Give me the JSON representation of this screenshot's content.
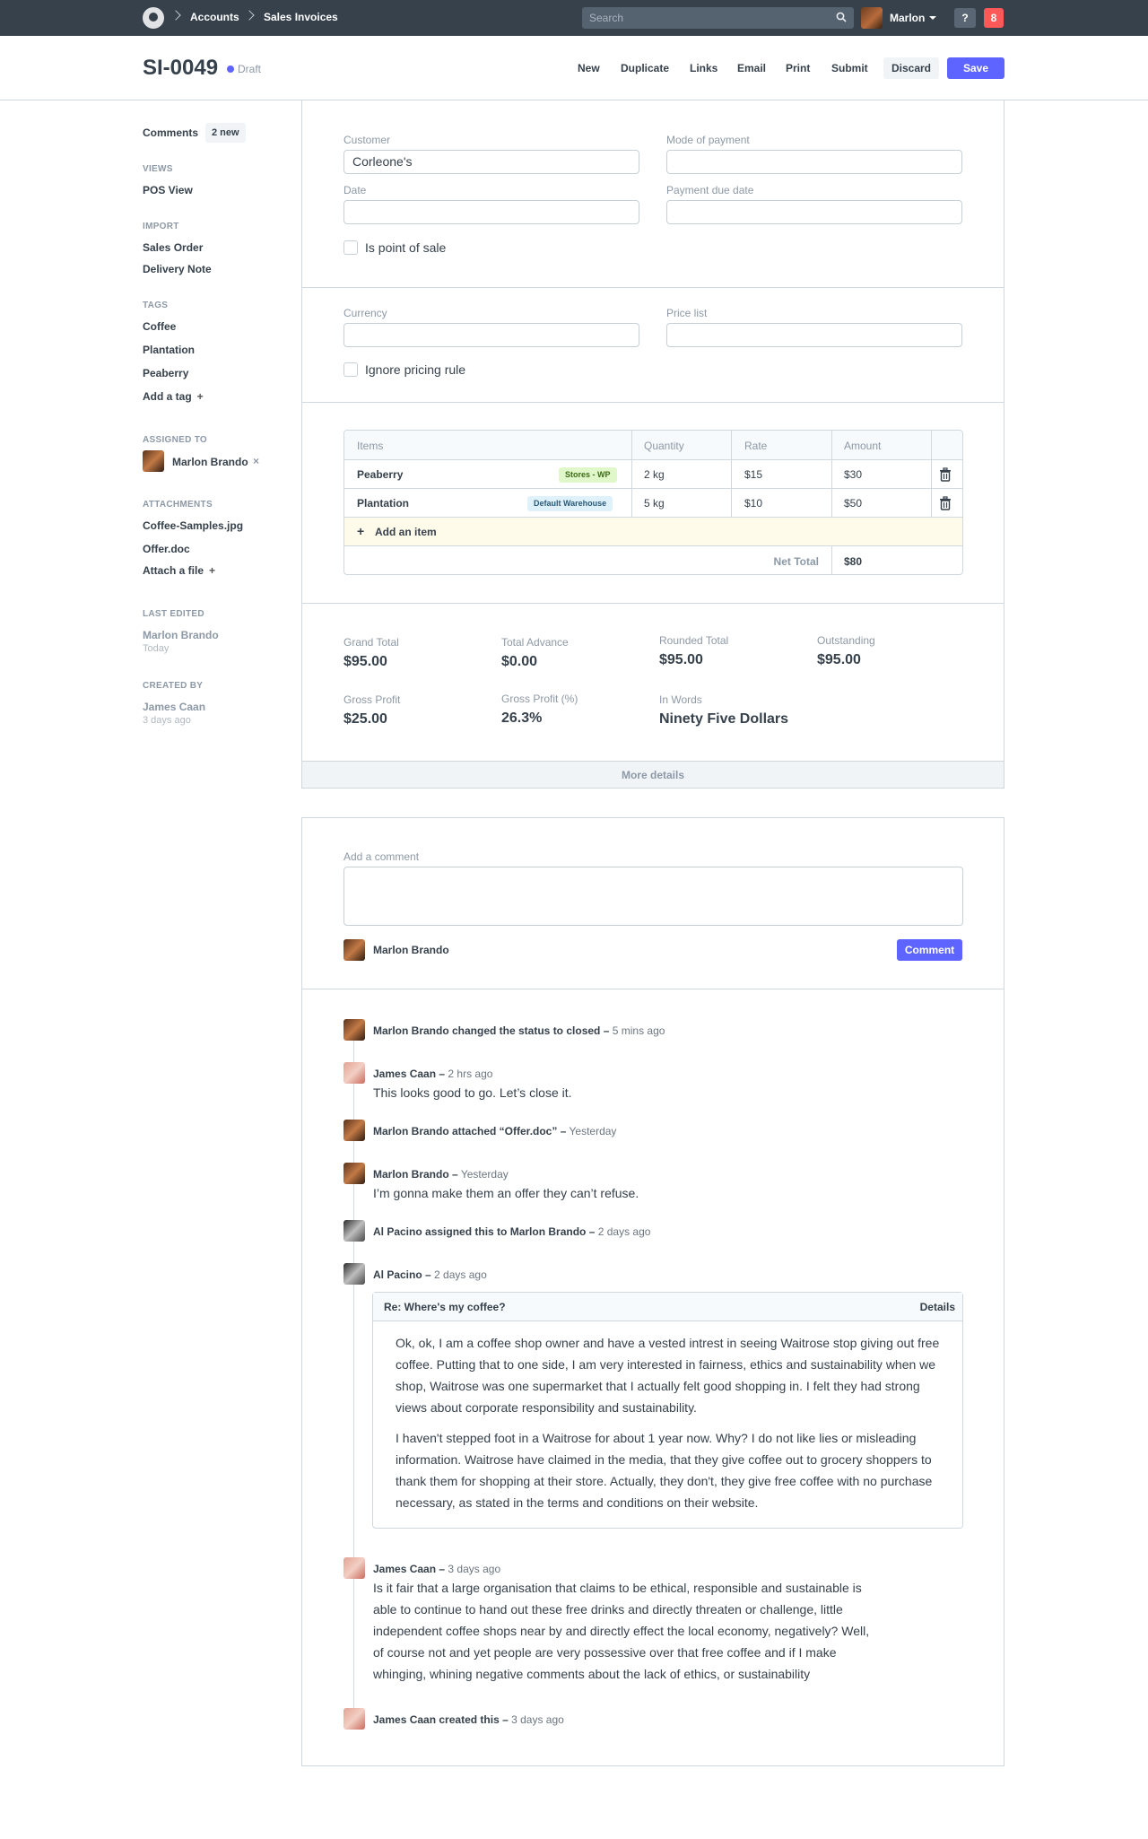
{
  "nav": {
    "breadcrumbs": [
      "Accounts",
      "Sales Invoices"
    ],
    "search_placeholder": "Search",
    "user_name": "Marlon",
    "help": "?",
    "notifications": "8"
  },
  "header": {
    "doc_id": "SI-0049",
    "status": "Draft",
    "actions": [
      "New",
      "Duplicate",
      "Links",
      "Email",
      "Print",
      "Submit"
    ],
    "discard": "Discard",
    "save": "Save"
  },
  "sidebar": {
    "comments_label": "Comments",
    "comments_badge": "2 new",
    "views_label": "Views",
    "views": [
      "POS View"
    ],
    "import_label": "Import",
    "imports": [
      "Sales Order",
      "Delivery Note"
    ],
    "tags_label": "Tags",
    "tags": [
      "Coffee",
      "Plantation",
      "Peaberry"
    ],
    "add_tag": "Add a tag",
    "assigned_label": "Assigned to",
    "assigned_to": "Marlon Brando",
    "attachments_label": "Attachments",
    "attachments": [
      "Coffee-Samples.jpg",
      "Offer.doc"
    ],
    "attach_file": "Attach a file",
    "last_edited_label": "Last edited",
    "last_edited_by": "Marlon Brando",
    "last_edited_when": "Today",
    "created_label": "Created by",
    "created_by": "James Caan",
    "created_when": "3 days ago"
  },
  "form": {
    "customer_label": "Customer",
    "customer_value": "Corleone's",
    "mode_label": "Mode of payment",
    "date_label": "Date",
    "due_label": "Payment due date",
    "pos_label": "Is point of sale",
    "currency_label": "Currency",
    "pricelist_label": "Price list",
    "ignore_label": "Ignore pricing rule"
  },
  "items": {
    "headers": [
      "Items",
      "Quantity",
      "Rate",
      "Amount"
    ],
    "rows": [
      {
        "item": "Peaberry",
        "warehouse": "Stores - WP",
        "qty": "2 kg",
        "rate": "$15",
        "amount": "$30"
      },
      {
        "item": "Plantation",
        "warehouse": "Default Warehouse",
        "qty": "5 kg",
        "rate": "$10",
        "amount": "$50"
      }
    ],
    "add_item": "Add an item",
    "net_total_label": "Net Total",
    "net_total": "$80"
  },
  "totals": {
    "grand_total_label": "Grand Total",
    "grand_total": "$95.00",
    "total_advance_label": "Total Advance",
    "total_advance": "$0.00",
    "rounded_total_label": "Rounded Total",
    "rounded_total": "$95.00",
    "outstanding_label": "Outstanding",
    "outstanding": "$95.00",
    "gross_profit_label": "Gross Profit",
    "gross_profit": "$25.00",
    "gross_profit_pct_label": "Gross Profit (%)",
    "gross_profit_pct": "26.3%",
    "in_words_label": "In Words",
    "in_words": "Ninety Five Dollars",
    "more_details": "More details"
  },
  "comments": {
    "add_label": "Add a comment",
    "author": "Marlon Brando",
    "button": "Comment"
  },
  "timeline": {
    "t1_text": "Marlon Brando changed the status to closed –",
    "t1_time": "5 mins ago",
    "t2_author": "James Caan –",
    "t2_time": "2 hrs ago",
    "t2_body": "This looks good to go. Let’s close it.",
    "t3_text": "Marlon Brando attached “Offer.doc” –",
    "t3_time": "Yesterday",
    "t4_author": "Marlon Brando –",
    "t4_time": "Yesterday",
    "t4_body": "I’m gonna make them an offer they can’t refuse.",
    "t5_text": "Al Pacino assigned this to Marlon Brando –",
    "t5_time": "2 days ago",
    "t6_author": "Al Pacino –",
    "t6_time": "2 days ago",
    "email_subject": "Re: Where's my coffee?",
    "email_details": "Details",
    "email_p1": "Ok, ok, I am a coffee shop owner and have a vested intrest in seeing Waitrose stop giving out free coffee. Putting that to one side, I am very interested in fairness, ethics and sustainability when we shop, Waitrose was one supermarket that I actually felt good shopping in. I felt they had strong views about corporate responsibility and sustainability.",
    "email_p2": "I haven't stepped foot in a Waitrose for about 1 year now. Why? I do not like lies or misleading information. Waitrose have claimed in the media, that they give coffee out to grocery shoppers to thank them for shopping at their store. Actually, they don't, they give free coffee with no purchase necessary, as stated in the terms and conditions on their website.",
    "t7_author": "James Caan –",
    "t7_time": "3 days ago",
    "t7_body": "Is it fair that a large organisation that claims to be ethical, responsible and sustainable is able to continue to hand out these free drinks and directly threaten or challenge, little independent coffee shops near by and directly effect the local economy, negatively? Well, of course not and yet people are very possessive over that free coffee and if I make whinging, whining negative comments about the lack of ethics, or sustainability",
    "t8_text": "James Caan created this –",
    "t8_time": "3 days ago"
  }
}
